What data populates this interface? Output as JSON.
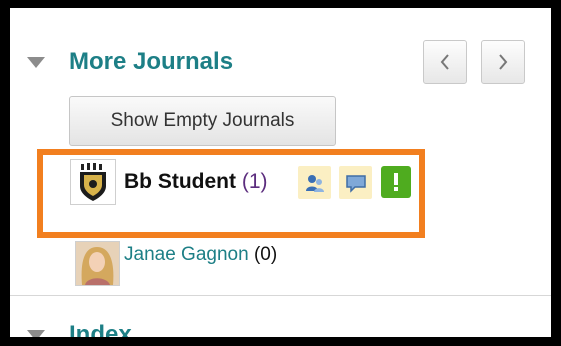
{
  "journals": {
    "section_title": "More Journals",
    "prev_label": "‹",
    "next_label": "›",
    "show_empty_label": "Show Empty Journals",
    "entries": [
      {
        "name": "Bb Student",
        "count": "(1)",
        "avatar": "crest-avatar-icon",
        "badges": [
          "users-icon",
          "comment-icon",
          "alert-icon"
        ]
      },
      {
        "name": "Janae Gagnon",
        "count": "(0)",
        "avatar": "photo-avatar-icon"
      }
    ]
  },
  "index": {
    "section_title": "Index"
  },
  "colors": {
    "accent": "#1d7f86",
    "highlight": "#f27f1f",
    "badge_bg": "#fbefc3",
    "alert_green": "#4fac1f"
  }
}
